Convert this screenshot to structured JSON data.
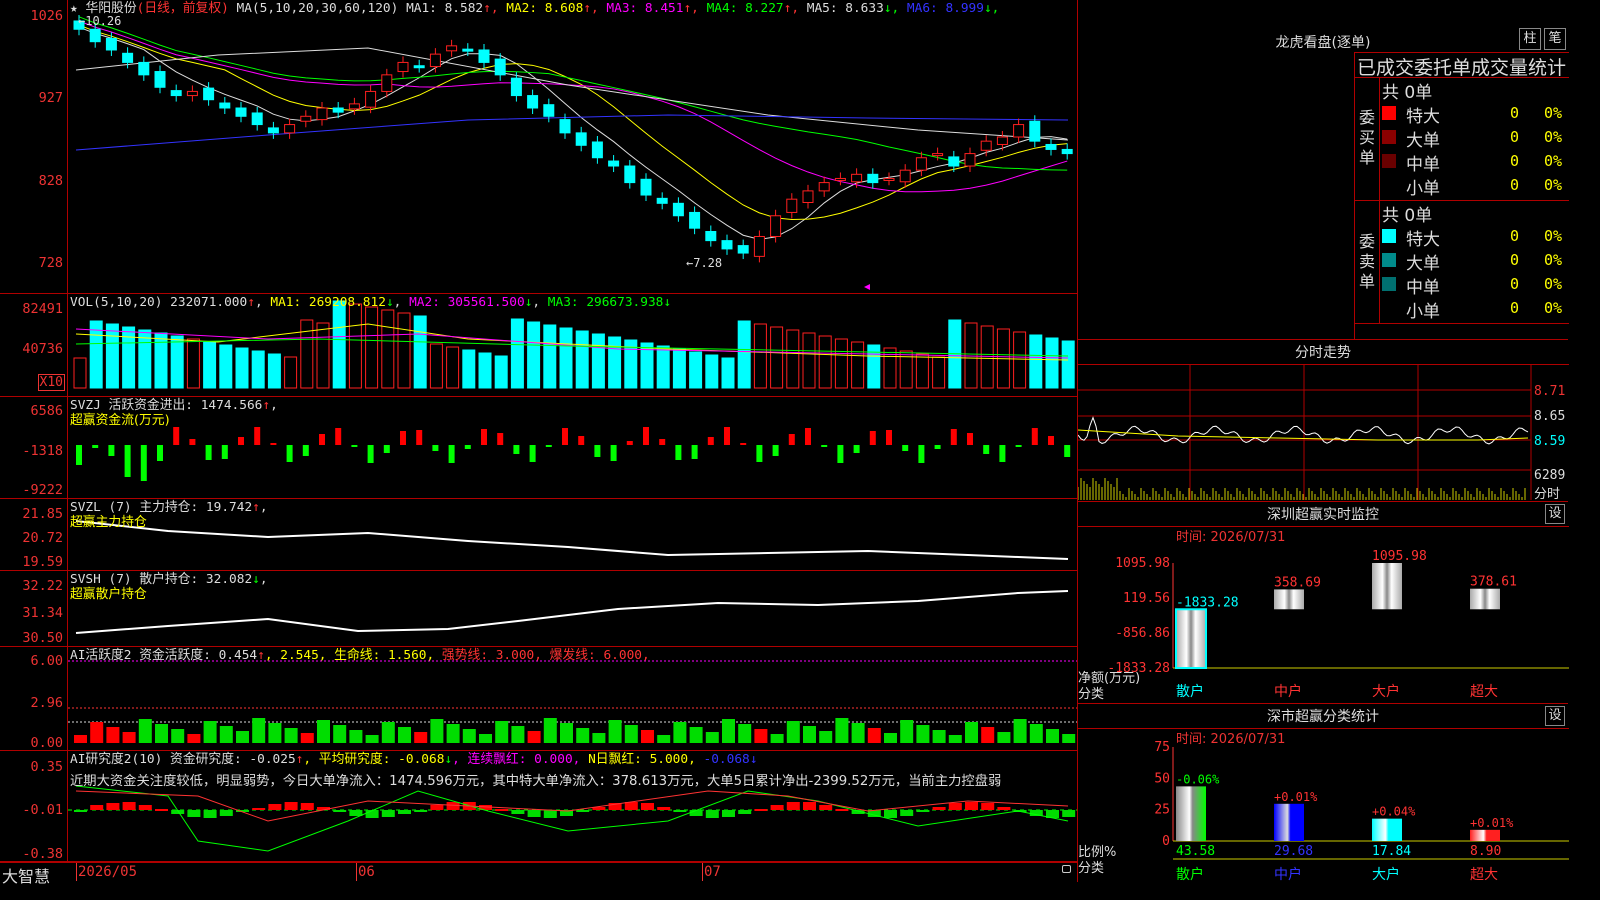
{
  "stock": {
    "name": "华阳股份",
    "mode": "(日线，前复权)",
    "star": "★"
  },
  "k_panel": {
    "ma_header": "MA(5,10,20,30,60,120)",
    "ma": [
      {
        "label": "MA1:",
        "value": "8.582",
        "arrow": "↑",
        "color": "#dddddd"
      },
      {
        "label": "MA2:",
        "value": "8.608",
        "arrow": "↑",
        "color": "#ffff00"
      },
      {
        "label": "MA3:",
        "value": "8.451",
        "arrow": "↑",
        "color": "#ff00ff"
      },
      {
        "label": "MA4:",
        "value": "8.227",
        "arrow": "↑",
        "color": "#00ff00"
      },
      {
        "label": "MA5:",
        "value": "8.633",
        "arrow": "↓",
        "color": "#dddddd"
      },
      {
        "label": "MA6:",
        "value": "8.999",
        "arrow": "↓",
        "color": "#3333ff"
      }
    ],
    "y_labels": [
      "1026",
      "927",
      "828",
      "728"
    ],
    "high_mark": "10.26",
    "low_mark": "7.28"
  },
  "vol_panel": {
    "header": {
      "name": "VOL(5,10,20)",
      "value": "232071.000",
      "arrow": "↑",
      "ma1": "MA1: 269208.812",
      "ma1_arrow": "↓",
      "ma2": "MA2: 305561.500",
      "ma2_arrow": "↓",
      "ma3": "MA3: 296673.938",
      "ma3_arrow": "↓"
    },
    "y_labels": [
      "82491",
      "40736"
    ],
    "unit": "X10"
  },
  "svzj_panel": {
    "header": "SVZJ  活跃资金进出: 1474.566",
    "arrow": "↑",
    "sub": "超赢资金流(万元)",
    "y_labels": [
      "6586",
      "-1318",
      "-9222"
    ]
  },
  "svzl_panel": {
    "header": "SVZL (7) 主力持仓: 19.742",
    "arrow": "↑",
    "sub": "超赢主力持仓",
    "y_labels": [
      "21.85",
      "20.72",
      "19.59"
    ]
  },
  "svsh_panel": {
    "header": "SVSH (7) 散户持仓: 32.082",
    "arrow": "↓",
    "sub": "超赢散户持仓",
    "y_labels": [
      "32.22",
      "31.34",
      "30.50"
    ]
  },
  "ai_active_panel": {
    "header_a": "AI活跃度2 资金活跃度: 0.454",
    "arrow_a": "↑",
    "header_b": ", 2.545, 生命线: 1.560,",
    "header_c": " 强势线: 3.000, 爆发线: 6.000,",
    "y_labels": [
      "6.00",
      "2.96",
      "0.00"
    ]
  },
  "ai_research_panel": {
    "header_a": "AI研究度2(10) 资金研究度: -0.025",
    "arrow_a": "↑",
    "header_b": ", 平均研究度: -0.068",
    "arrow_b": "↓",
    "header_c": ", 连续飘红: 0.000,",
    "header_d": " N日飘红: 5.000,",
    "header_e": " -0.068",
    "arrow_e": "↓",
    "comment": "近期大资金关注度较低，明显弱势，今日大单净流入：1474.596万元，其中特大单净流入：378.613万元，大单5日累计净出-2399.52万元，当前主力控盘弱",
    "y_labels": [
      "0.35",
      "-0.01",
      "-0.38"
    ]
  },
  "footer": {
    "brand": "大智慧",
    "dates": [
      "2026/05",
      "06",
      "07"
    ]
  },
  "dragon_tiger": {
    "title": "龙虎看盘(逐单)",
    "btn_bar": "柱",
    "btn_pen": "笔",
    "subtitle": "已成交委托单成交量统计",
    "buy": {
      "side_label": "委买单",
      "total": "共 0单",
      "rows": [
        {
          "label": "特大",
          "value": "0",
          "pct": "0%",
          "color": "#ff0000"
        },
        {
          "label": "大单",
          "value": "0",
          "pct": "0%",
          "color": "#8b0000"
        },
        {
          "label": "中单",
          "value": "0",
          "pct": "0%",
          "color": "#6a0000"
        },
        {
          "label": "小单",
          "value": "0",
          "pct": "0%",
          "color": "#000000"
        }
      ]
    },
    "sell": {
      "side_label": "委卖单",
      "total": "共 0单",
      "rows": [
        {
          "label": "特大",
          "value": "0",
          "pct": "0%",
          "color": "#00ffff"
        },
        {
          "label": "大单",
          "value": "0",
          "pct": "0%",
          "color": "#008b8b"
        },
        {
          "label": "中单",
          "value": "0",
          "pct": "0%",
          "color": "#007070"
        },
        {
          "label": "小单",
          "value": "0",
          "pct": "0%",
          "color": "#000000"
        }
      ]
    }
  },
  "intraday": {
    "title": "分时走势",
    "y_labels": [
      "8.71",
      "8.65",
      "8.59"
    ],
    "vol_label": "6289",
    "unit": "分时"
  },
  "monitor": {
    "title": "深圳超赢实时监控",
    "gear": "设",
    "date": "时间: 2026/07/31",
    "y_labels": [
      "1095.98",
      "119.56",
      "-856.86",
      "-1833.28"
    ],
    "unit_a": "净额(万元)",
    "unit_b": "分类",
    "chart_data": {
      "type": "bar",
      "categories": [
        "散户",
        "中户",
        "大户",
        "超大"
      ],
      "values": [
        -1833.28,
        358.69,
        1095.98,
        378.61
      ],
      "labels": [
        "-1833.28",
        "358.69",
        "1095.98",
        "378.61"
      ],
      "ylim": [
        -1833.28,
        1095.98
      ]
    }
  },
  "classify": {
    "title": "深市超赢分类统计",
    "gear": "设",
    "date": "时间: 2026/07/31",
    "y_labels": [
      "75",
      "50",
      "25",
      "0"
    ],
    "unit_a": "比例%",
    "unit_b": "分类",
    "chart_data": {
      "type": "bar",
      "categories": [
        "散户",
        "中户",
        "大户",
        "超大"
      ],
      "values": [
        43.58,
        29.68,
        17.84,
        8.9
      ],
      "changes": [
        "-0.06%",
        "+0.01%",
        "+0.04%",
        "+0.01%"
      ],
      "ylim": [
        0,
        75
      ]
    }
  },
  "colors": {
    "up": "#ff2020",
    "down": "#00ffff",
    "grid": "#b00000",
    "ma1": "#dddddd",
    "ma2": "#ffff00",
    "ma3": "#ff00ff",
    "ma4": "#00ff00",
    "ma6": "#3333ff"
  }
}
